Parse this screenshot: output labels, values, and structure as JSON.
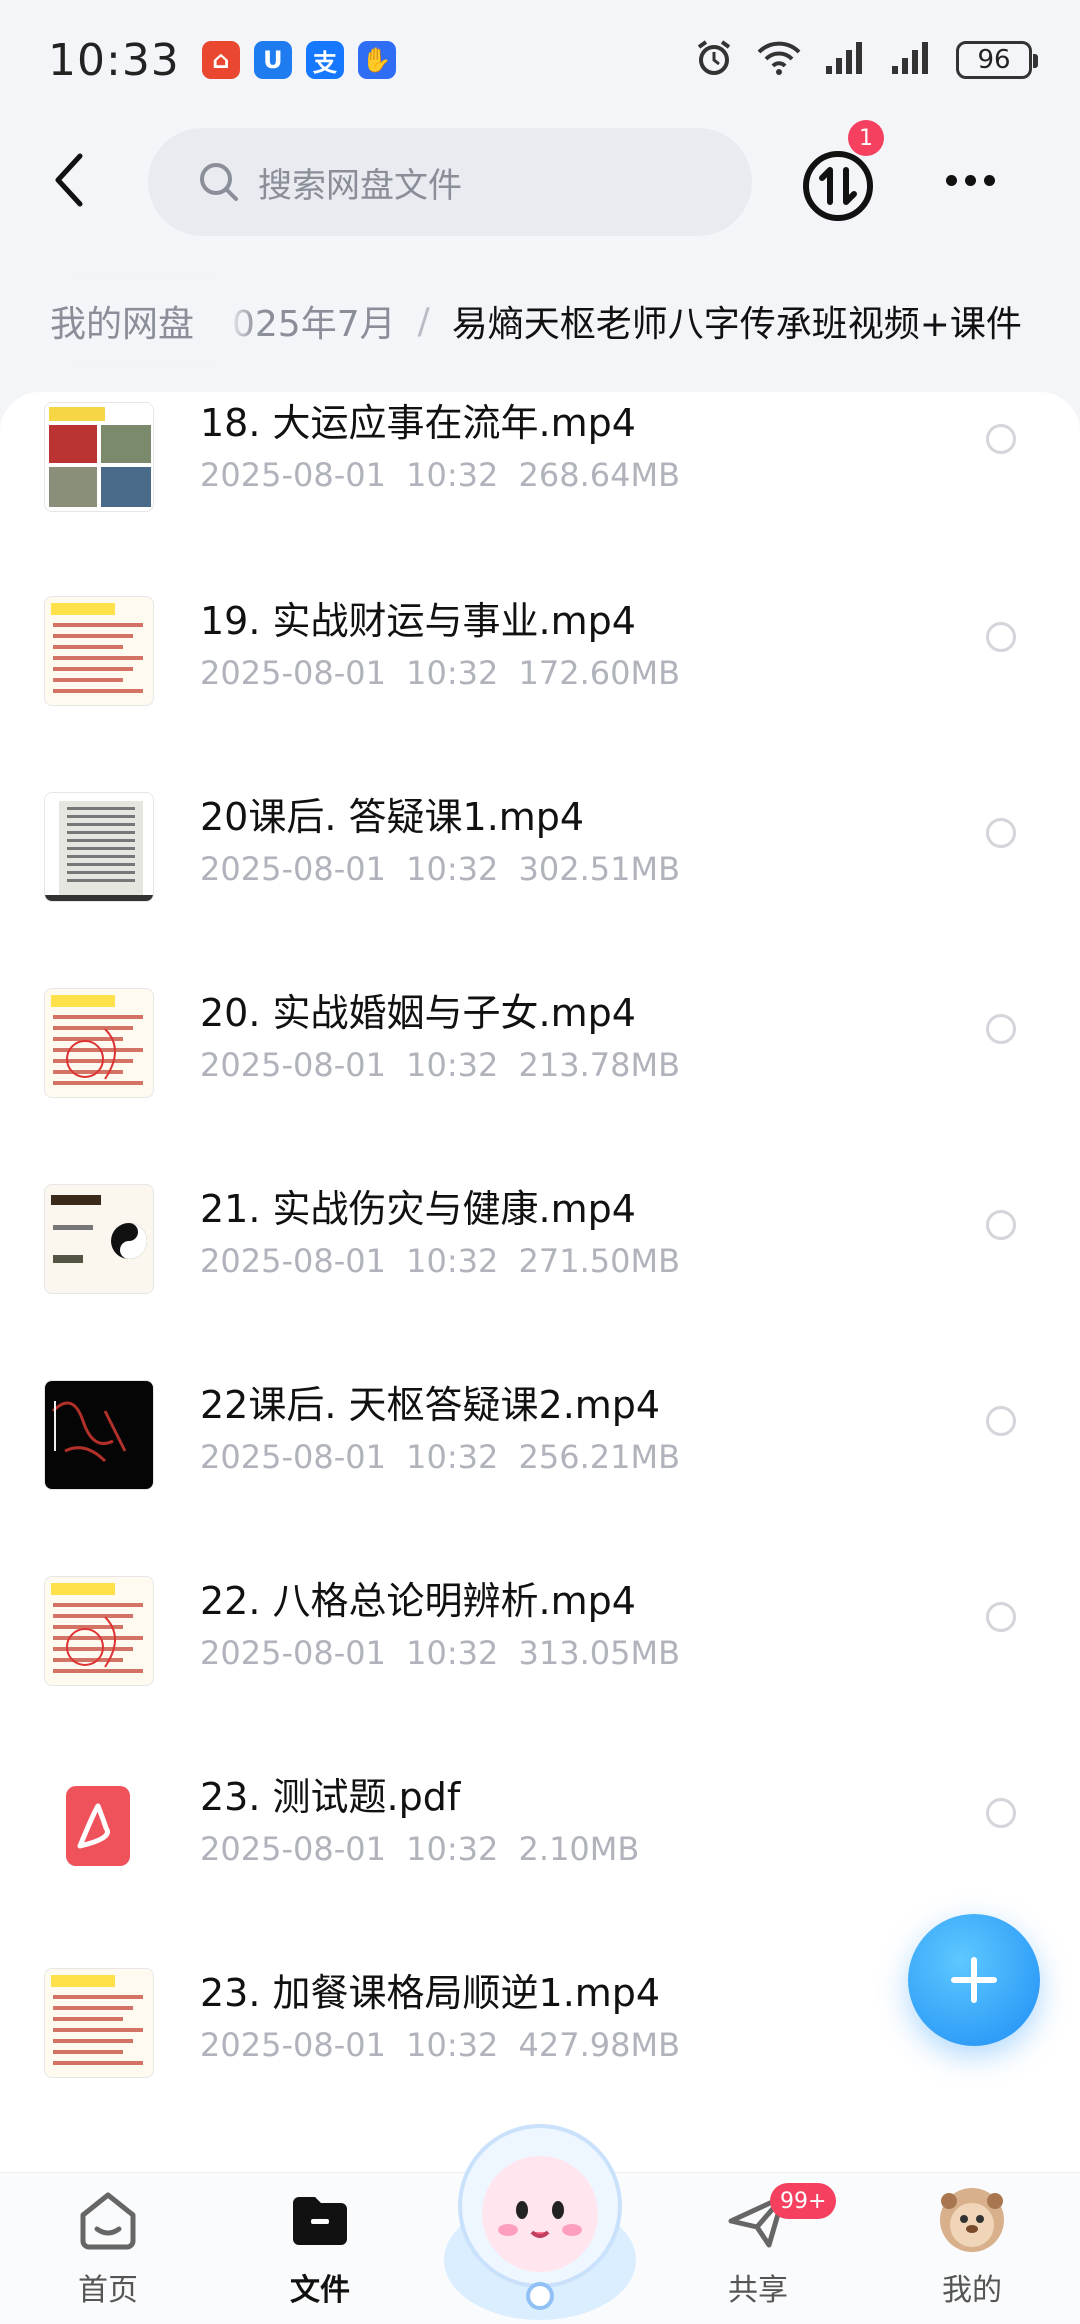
{
  "status_bar": {
    "time": "10:33",
    "battery": "96",
    "app_icons": [
      {
        "icon": "red-app-icon",
        "color": "#e9472f",
        "glyph": "⌂"
      },
      {
        "icon": "blue-app-icon",
        "color": "#1f7cf0",
        "glyph": "U"
      },
      {
        "icon": "alipay-icon",
        "color": "#1677ff",
        "glyph": "支"
      },
      {
        "icon": "hand-app-icon",
        "color": "#2f6df5",
        "glyph": "✋"
      }
    ]
  },
  "header": {
    "search_placeholder": "搜索网盘文件",
    "transfer_badge": "1"
  },
  "breadcrumb": {
    "root": "我的网盘",
    "middle": "025年7月",
    "separator": "/",
    "current": "易熵天枢老师八字传承班视频+课件"
  },
  "files": [
    {
      "name": "18. 大运应事在流年.mp4",
      "date": "2025-08-01",
      "time": "10:32",
      "size": "268.64MB",
      "thumb": "photos"
    },
    {
      "name": "19. 实战财运与事业.mp4",
      "date": "2025-08-01",
      "time": "10:32",
      "size": "172.60MB",
      "thumb": "doc"
    },
    {
      "name": "20课后. 答疑课1.mp4",
      "date": "2025-08-01",
      "time": "10:32",
      "size": "302.51MB",
      "thumb": "table"
    },
    {
      "name": "20. 实战婚姻与子女.mp4",
      "date": "2025-08-01",
      "time": "10:32",
      "size": "213.78MB",
      "thumb": "doc-red"
    },
    {
      "name": "21. 实战伤灾与健康.mp4",
      "date": "2025-08-01",
      "time": "10:32",
      "size": "271.50MB",
      "thumb": "taiji"
    },
    {
      "name": "22课后. 天枢答疑课2.mp4",
      "date": "2025-08-01",
      "time": "10:32",
      "size": "256.21MB",
      "thumb": "black"
    },
    {
      "name": "22. 八格总论明辨析.mp4",
      "date": "2025-08-01",
      "time": "10:32",
      "size": "313.05MB",
      "thumb": "doc-red"
    },
    {
      "name": "23. 测试题.pdf",
      "date": "2025-08-01",
      "time": "10:32",
      "size": "2.10MB",
      "thumb": "pdf"
    },
    {
      "name": "23. 加餐课格局顺逆1.mp4",
      "date": "2025-08-01",
      "time": "10:32",
      "size": "427.98MB",
      "thumb": "doc"
    }
  ],
  "tabs": [
    {
      "label": "首页",
      "icon": "home-icon",
      "active": false
    },
    {
      "label": "文件",
      "icon": "folder-icon",
      "active": true
    },
    {
      "label": "共享",
      "icon": "send-icon",
      "active": false,
      "badge": "99+"
    },
    {
      "label": "我的",
      "icon": "avatar-icon",
      "active": false
    }
  ],
  "colors": {
    "accent": "#1e8ef5",
    "badge": "#f5405f",
    "muted_text": "#b0b3bb"
  }
}
